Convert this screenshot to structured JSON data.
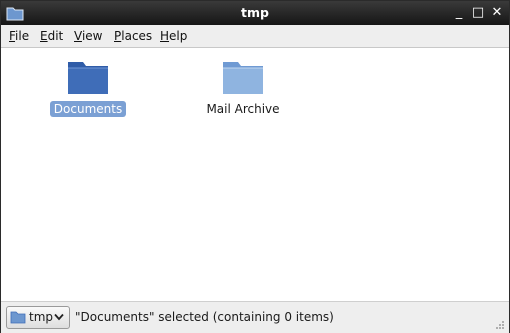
{
  "window": {
    "title": "tmp"
  },
  "menu": [
    "File",
    "Edit",
    "View",
    "Places",
    "Help"
  ],
  "menu_underline": [
    "F",
    "E",
    "V",
    "P",
    "H"
  ],
  "items": [
    {
      "label": "Documents",
      "selected": true
    },
    {
      "label": "Mail Archive",
      "selected": false
    }
  ],
  "statusbar": {
    "path": "tmp",
    "status_text": "\"Documents\" selected (containing 0 items)"
  },
  "colors": {
    "selection": "#7ba0d4",
    "folder_selected": "#3f6db8",
    "folder": "#8fb4e0"
  }
}
